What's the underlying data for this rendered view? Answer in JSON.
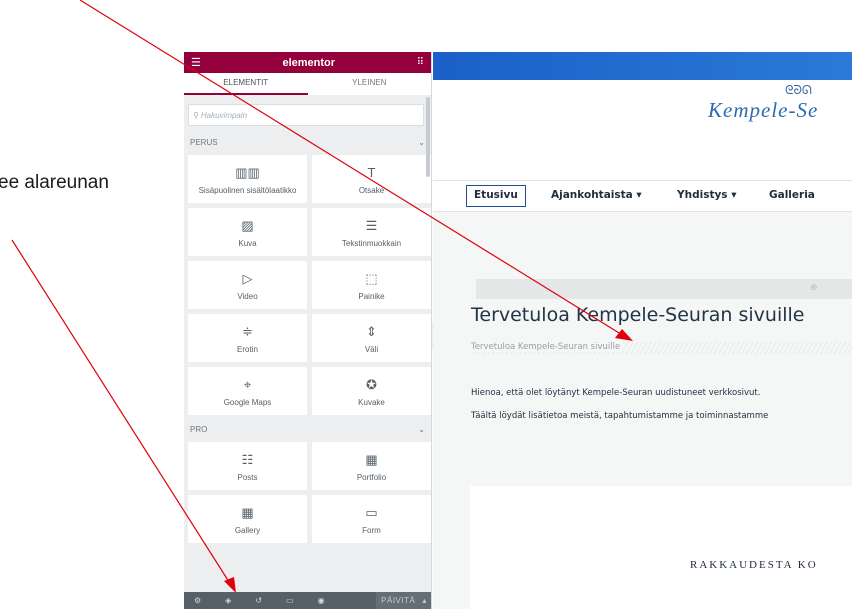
{
  "caption": "ee alareunan",
  "panel": {
    "brand": "elementor",
    "tabs": [
      "ELEMENTIT",
      "YLEINEN"
    ],
    "search_placeholder": "Hakuvimpain",
    "sections": [
      {
        "title": "PERUS",
        "widgets": [
          {
            "label": "Sisäpuolinen sisältölaatikko",
            "icon": "inner-section-icon"
          },
          {
            "label": "Otsake",
            "icon": "heading-icon"
          },
          {
            "label": "Kuva",
            "icon": "image-icon"
          },
          {
            "label": "Tekstinmuokkain",
            "icon": "text-editor-icon"
          },
          {
            "label": "Video",
            "icon": "video-icon"
          },
          {
            "label": "Painike",
            "icon": "button-icon"
          },
          {
            "label": "Erotin",
            "icon": "divider-icon"
          },
          {
            "label": "Väli",
            "icon": "spacer-icon"
          },
          {
            "label": "Google Maps",
            "icon": "map-icon"
          },
          {
            "label": "Kuvake",
            "icon": "star-icon"
          }
        ]
      },
      {
        "title": "PRO",
        "widgets": [
          {
            "label": "Posts",
            "icon": "posts-icon"
          },
          {
            "label": "Portfolio",
            "icon": "portfolio-icon"
          },
          {
            "label": "Gallery",
            "icon": "gallery-icon"
          },
          {
            "label": "Form",
            "icon": "form-icon"
          }
        ]
      }
    ],
    "footer": {
      "publish_label": "PÄIVITÄ"
    }
  },
  "site": {
    "title": "Kempele-Se",
    "nav": [
      "Etusivu",
      "Ajankohtaista ▾",
      "Yhdistys ▾",
      "Galleria"
    ],
    "welcome_title": "Tervetuloa Kempele-Seuran sivuille",
    "welcome_sub": "Tervetuloa Kempele-Seuran sivuille",
    "paragraphs": [
      "Hienoa, että olet löytänyt Kempele-Seuran uudistuneet verkkosivut.",
      "Täältä löydät lisätietoa meistä, tapahtumistamme ja toiminnastamme"
    ],
    "card_text": "RAKKAUDESTA KO"
  },
  "colors": {
    "elementor_brand": "#93003c",
    "annotation_arrow": "#e0000a",
    "site_blue": "#2d6ab0"
  }
}
